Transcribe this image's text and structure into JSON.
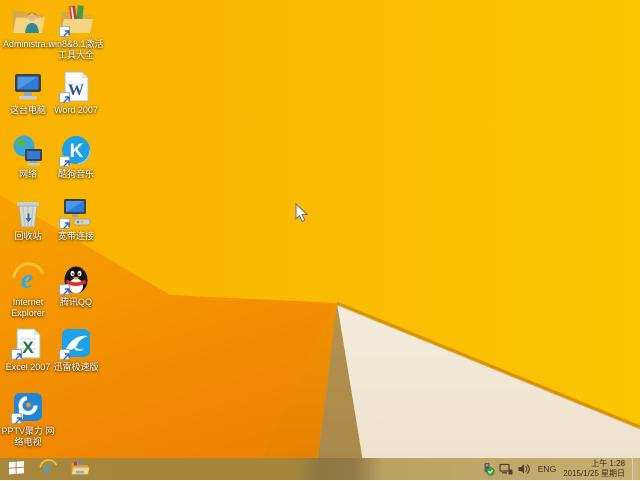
{
  "desktop": {
    "wallpaper_name": "windows-8.1-orange-facets",
    "icons": [
      {
        "id": "administrator",
        "label": "Administra...",
        "icon": "user-folder-icon",
        "shortcut": false,
        "col": 0,
        "row": 0
      },
      {
        "id": "win8-activation-tools",
        "label": "win8&8.1激活工具大全",
        "icon": "software-folder-icon",
        "shortcut": true,
        "col": 1,
        "row": 0
      },
      {
        "id": "this-pc",
        "label": "这台电脑",
        "icon": "computer-icon",
        "shortcut": false,
        "col": 0,
        "row": 1
      },
      {
        "id": "word-2007",
        "label": "Word 2007",
        "icon": "word-document-icon",
        "shortcut": true,
        "col": 1,
        "row": 1
      },
      {
        "id": "network",
        "label": "网络",
        "icon": "network-globe-icon",
        "shortcut": false,
        "col": 0,
        "row": 2
      },
      {
        "id": "kugou-music",
        "label": "酷狗音乐",
        "icon": "kugou-music-icon",
        "shortcut": true,
        "col": 1,
        "row": 2
      },
      {
        "id": "recycle-bin",
        "label": "回收站",
        "icon": "recycle-bin-icon",
        "shortcut": false,
        "col": 0,
        "row": 3
      },
      {
        "id": "broadband-connection",
        "label": "宽带连接",
        "icon": "broadband-connection-icon",
        "shortcut": true,
        "col": 1,
        "row": 3
      },
      {
        "id": "internet-explorer",
        "label": "Internet Explorer",
        "icon": "internet-explorer-icon",
        "shortcut": false,
        "col": 0,
        "row": 4
      },
      {
        "id": "tencent-qq",
        "label": "腾讯QQ",
        "icon": "qq-penguin-icon",
        "shortcut": true,
        "col": 1,
        "row": 4
      },
      {
        "id": "excel-2007",
        "label": "Excel 2007",
        "icon": "excel-icon",
        "shortcut": true,
        "col": 0,
        "row": 5
      },
      {
        "id": "xunlei-speed",
        "label": "迅雷极速版",
        "icon": "xunlei-bird-icon",
        "shortcut": true,
        "col": 1,
        "row": 5
      },
      {
        "id": "pptv",
        "label": "PPTV聚力 网络电视",
        "icon": "pptv-icon",
        "shortcut": true,
        "col": 0,
        "row": 6
      }
    ]
  },
  "taskbar": {
    "buttons": [
      {
        "id": "start",
        "icon": "windows-start-icon"
      },
      {
        "id": "internet-explorer",
        "icon": "internet-explorer-icon"
      },
      {
        "id": "file-explorer",
        "icon": "file-explorer-icon"
      }
    ],
    "tray": {
      "icons": [
        "usb-safely-remove-icon",
        "network-status-icon",
        "volume-icon"
      ],
      "language": "ENG",
      "time": "上午 1:28",
      "date": "2015/1/25 星期日"
    }
  },
  "colors": {
    "wallpaper_gold": "#FAB201",
    "wallpaper_gold_right": "#FBC503",
    "wallpaper_orange": "#F8A001",
    "wallpaper_orange_deep": "#EE8301",
    "facet_tan": "#B5924E",
    "facet_cream": "#F4ECDC",
    "ridge_line": "#DA9200",
    "taskbar_left": "#A6873B",
    "taskbar_right": "#C6AE72",
    "icon_label_text": "#FFFFFF",
    "tray_text": "#3A311A"
  }
}
